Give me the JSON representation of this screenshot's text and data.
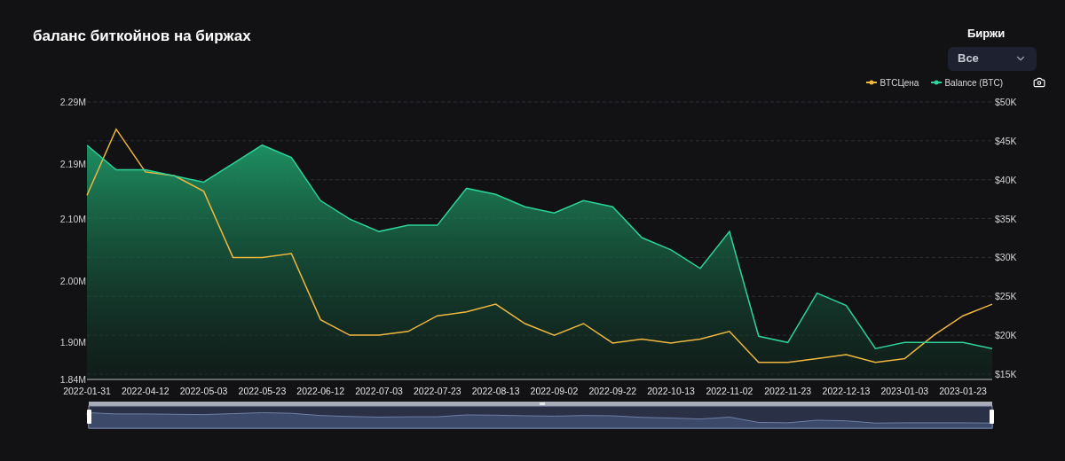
{
  "title": "баланс биткойнов на биржах",
  "filter": {
    "label": "Биржи",
    "value": "Все"
  },
  "chart": {
    "chart_data": {
      "type": "area",
      "categories": [
        "2022-01-31",
        null,
        "2022-04-12",
        null,
        "2022-05-03",
        null,
        "2022-05-23",
        null,
        "2022-06-12",
        null,
        "2022-07-03",
        null,
        "2022-07-23",
        null,
        "2022-08-13",
        null,
        "2022-09-02",
        null,
        "2022-09-22",
        null,
        "2022-10-13",
        null,
        "2022-11-02",
        null,
        "2022-11-23",
        null,
        "2022-12-13",
        null,
        "2023-01-03",
        null,
        "2023-01-23",
        null
      ],
      "grid": true,
      "ylim": [
        1.84,
        2.29
      ],
      "yticks": [
        {
          "value": 2.29,
          "label": "2.29M"
        },
        {
          "value": 2.19,
          "label": "2.19M"
        },
        {
          "value": 2.1,
          "label": "2.10M"
        },
        {
          "value": 2.0,
          "label": "2.00M"
        },
        {
          "value": 1.9,
          "label": "1.90M"
        },
        {
          "value": 1.84,
          "label": "1.84M"
        }
      ],
      "y2lim": [
        15,
        50
      ],
      "y2ticks": [
        {
          "value": 50,
          "label": "$50K"
        },
        {
          "value": 45,
          "label": "$45K"
        },
        {
          "value": 40,
          "label": "$40K"
        },
        {
          "value": 35,
          "label": "$35K"
        },
        {
          "value": 30,
          "label": "$30K"
        },
        {
          "value": 25,
          "label": "$25K"
        },
        {
          "value": 20,
          "label": "$20K"
        },
        {
          "value": 15,
          "label": "$15K"
        }
      ],
      "series": [
        {
          "name": "BTCЦена",
          "color": "#f0b83f",
          "axis": "y2",
          "type": "line",
          "values": [
            38,
            46.5,
            41,
            40.5,
            38.5,
            30,
            30,
            30.5,
            22,
            20,
            20,
            20.5,
            22.5,
            23,
            24,
            21.5,
            20,
            21.5,
            19,
            19.5,
            19,
            19.5,
            20.5,
            16.5,
            16.5,
            17,
            17.5,
            16.5,
            17,
            20,
            22.5,
            24
          ]
        },
        {
          "name": "Balance (BTC)",
          "color": "#2ed39a",
          "values": [
            2.22,
            2.18,
            2.18,
            2.17,
            2.16,
            2.19,
            2.22,
            2.2,
            2.13,
            2.1,
            2.08,
            2.09,
            2.09,
            2.15,
            2.14,
            2.12,
            2.11,
            2.13,
            2.12,
            2.07,
            2.05,
            2.02,
            2.08,
            1.91,
            1.9,
            1.98,
            1.96,
            1.89,
            1.9,
            1.9,
            1.9,
            1.89
          ]
        }
      ]
    }
  }
}
